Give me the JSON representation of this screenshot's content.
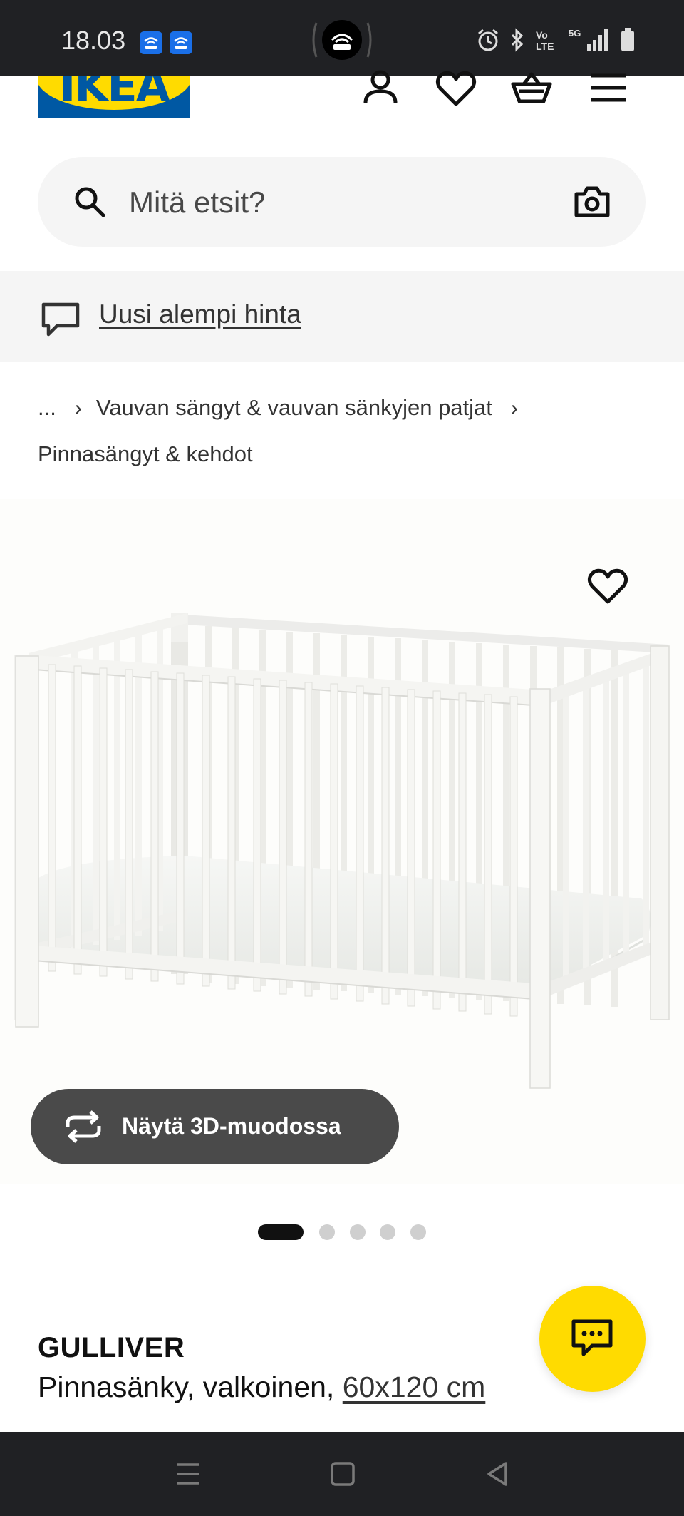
{
  "status_bar": {
    "time": "18.03",
    "network": "5G"
  },
  "header": {
    "logo_text": "IKEA"
  },
  "search": {
    "placeholder": "Mitä etsit?"
  },
  "banner": {
    "text": "Uusi alempi hinta"
  },
  "breadcrumb": {
    "ellipsis": "...",
    "category": "Vauvan sängyt & vauvan sänkyjen patjat",
    "current": "Pinnasängyt & kehdot"
  },
  "gallery": {
    "view_3d_label": "Näytä 3D-muodossa",
    "image_count": 5,
    "active_index": 1
  },
  "product": {
    "name": "GULLIVER",
    "description": "Pinnasänky, valkoinen,",
    "size": "60x120 cm"
  },
  "colors": {
    "ikea_blue": "#0058a3",
    "ikea_yellow": "#ffdb00",
    "button_dark": "#4a4a4a"
  }
}
